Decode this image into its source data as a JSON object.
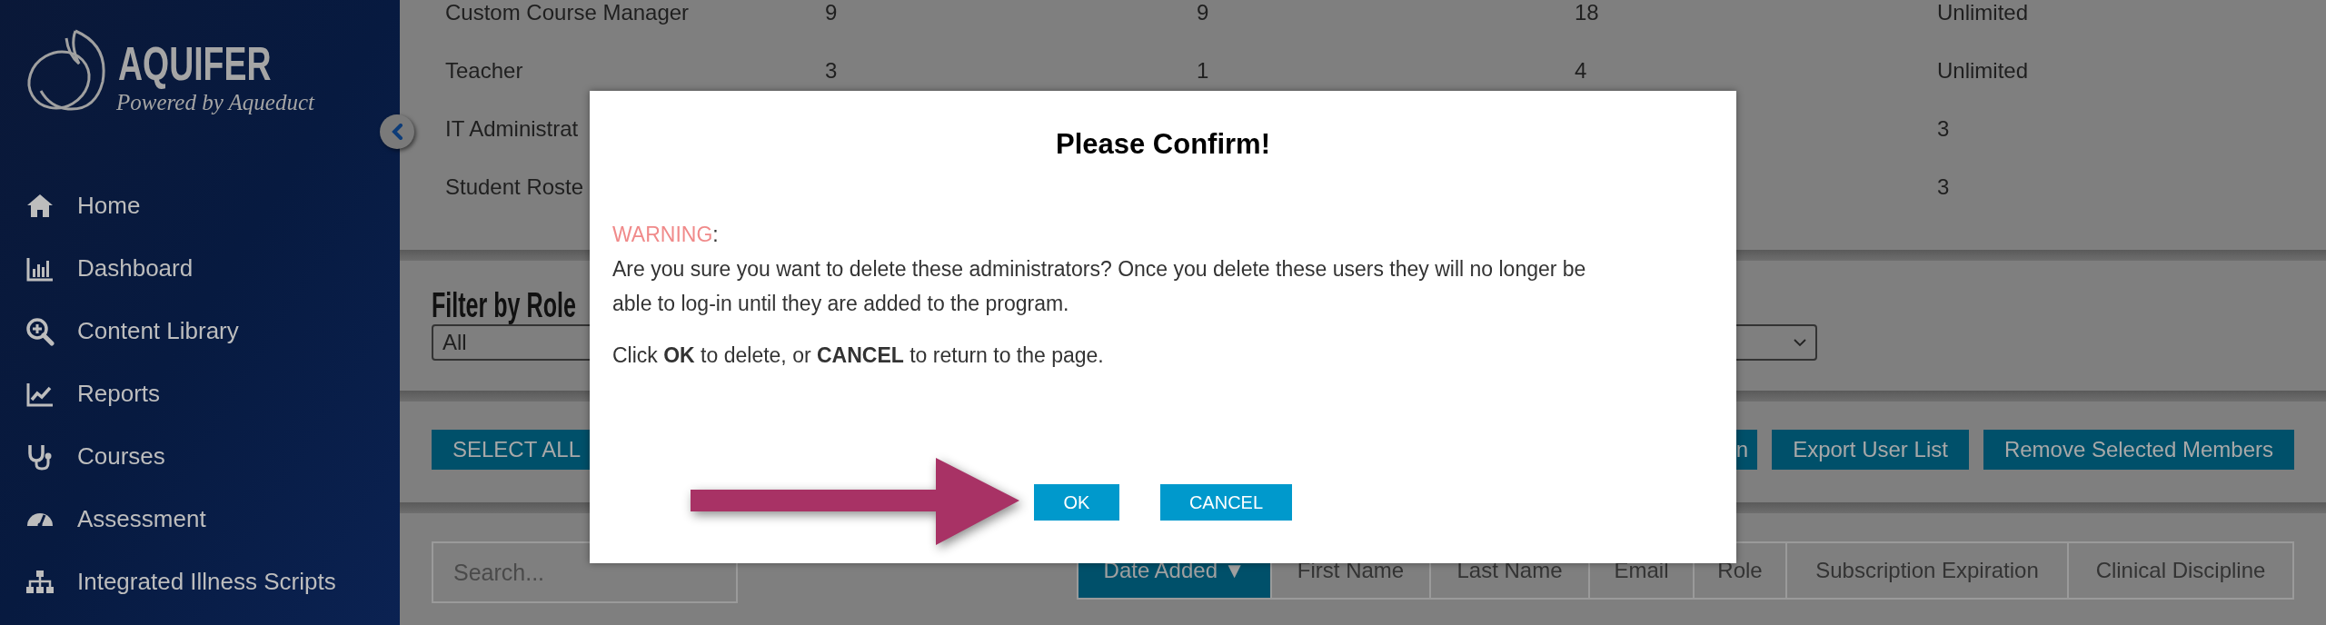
{
  "sidebar": {
    "logo": {
      "title": "AQUIFER",
      "subtitle": "Powered by Aqueduct"
    },
    "items": [
      {
        "label": "Home"
      },
      {
        "label": "Dashboard"
      },
      {
        "label": "Content Library"
      },
      {
        "label": "Reports"
      },
      {
        "label": "Courses"
      },
      {
        "label": "Assessment"
      },
      {
        "label": "Integrated Illness Scripts"
      }
    ]
  },
  "roles_table": {
    "rows": [
      {
        "role": "Custom Course Manager",
        "column_2": "9",
        "column_3": "9",
        "column_4": "18",
        "column_5": "Unlimited"
      },
      {
        "role": "Teacher",
        "column_2": "3",
        "column_3": "1",
        "column_4": "4",
        "column_5": "Unlimited"
      },
      {
        "role": "IT Administrat",
        "column_5": "3"
      },
      {
        "role": "Student Roste",
        "column_5": "3"
      }
    ]
  },
  "filter": {
    "label": "Filter by Role",
    "value": "All"
  },
  "actions": [
    {
      "label": "SELECT ALL"
    },
    {
      "label": "n"
    },
    {
      "label": "Export User List"
    },
    {
      "label": "Remove Selected Members"
    }
  ],
  "search": {
    "placeholder": "Search..."
  },
  "sort_tabs": [
    {
      "label": "Date Added ▼",
      "selected": true
    },
    {
      "label": "First Name",
      "selected": false
    },
    {
      "label": "Last Name",
      "selected": false
    },
    {
      "label": "Email",
      "selected": false
    },
    {
      "label": "Role",
      "selected": false
    },
    {
      "label": "Subscription Expiration",
      "selected": false
    },
    {
      "label": "Clinical Discipline",
      "selected": false
    }
  ],
  "dialog": {
    "title": "Please Confirm!",
    "warning": {
      "label": "WARNING",
      "suffix": ":"
    },
    "message": "Are you sure you want to delete these administrators? Once you delete these users they will no longer be able to log-in until they are added to the program.",
    "instruction": "Click **OK** to delete, or **CANCEL** to return to the page.",
    "buttons": [
      "OK",
      "CANCEL"
    ]
  }
}
